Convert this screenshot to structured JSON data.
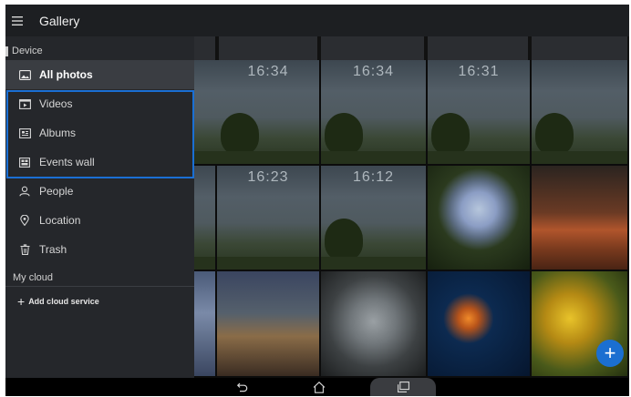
{
  "app": {
    "title": "Gallery"
  },
  "header": {
    "menu_icon": "hamburger-menu-icon"
  },
  "drawer": {
    "device_header": "Device",
    "items": [
      {
        "label": "All photos",
        "icon": "photo-icon",
        "active": true
      },
      {
        "label": "Videos",
        "icon": "video-icon",
        "active": false
      },
      {
        "label": "Albums",
        "icon": "album-icon",
        "active": false
      },
      {
        "label": "Events wall",
        "icon": "events-wall-icon",
        "active": false
      },
      {
        "label": "People",
        "icon": "person-icon",
        "active": false
      },
      {
        "label": "Location",
        "icon": "location-pin-icon",
        "active": false
      },
      {
        "label": "Trash",
        "icon": "trash-icon",
        "active": false
      }
    ],
    "cloud_header": "My cloud",
    "add_cloud_label": "Add cloud service",
    "highlight_color": "#1a6fd4"
  },
  "grid": {
    "thumbnails": [
      {
        "kind": "lock-screen",
        "clock": "16:34"
      },
      {
        "kind": "lock-screen",
        "clock": "16:34"
      },
      {
        "kind": "lock-screen",
        "clock": "16:31"
      },
      {
        "kind": "lock-screen",
        "clock": ""
      },
      {
        "kind": "lock-screen",
        "clock": "16:23"
      },
      {
        "kind": "lock-screen",
        "clock": "16:12"
      },
      {
        "kind": "hydrangea-flower"
      },
      {
        "kind": "desert"
      },
      {
        "kind": "lighthouse"
      },
      {
        "kind": "koala"
      },
      {
        "kind": "jellyfish"
      },
      {
        "kind": "tulips"
      }
    ],
    "fab_icon": "plus-icon",
    "accent": "#1b6fd1"
  },
  "navbar": {
    "back_icon": "back-icon",
    "home_icon": "home-icon",
    "recents_icon": "recents-icon"
  }
}
